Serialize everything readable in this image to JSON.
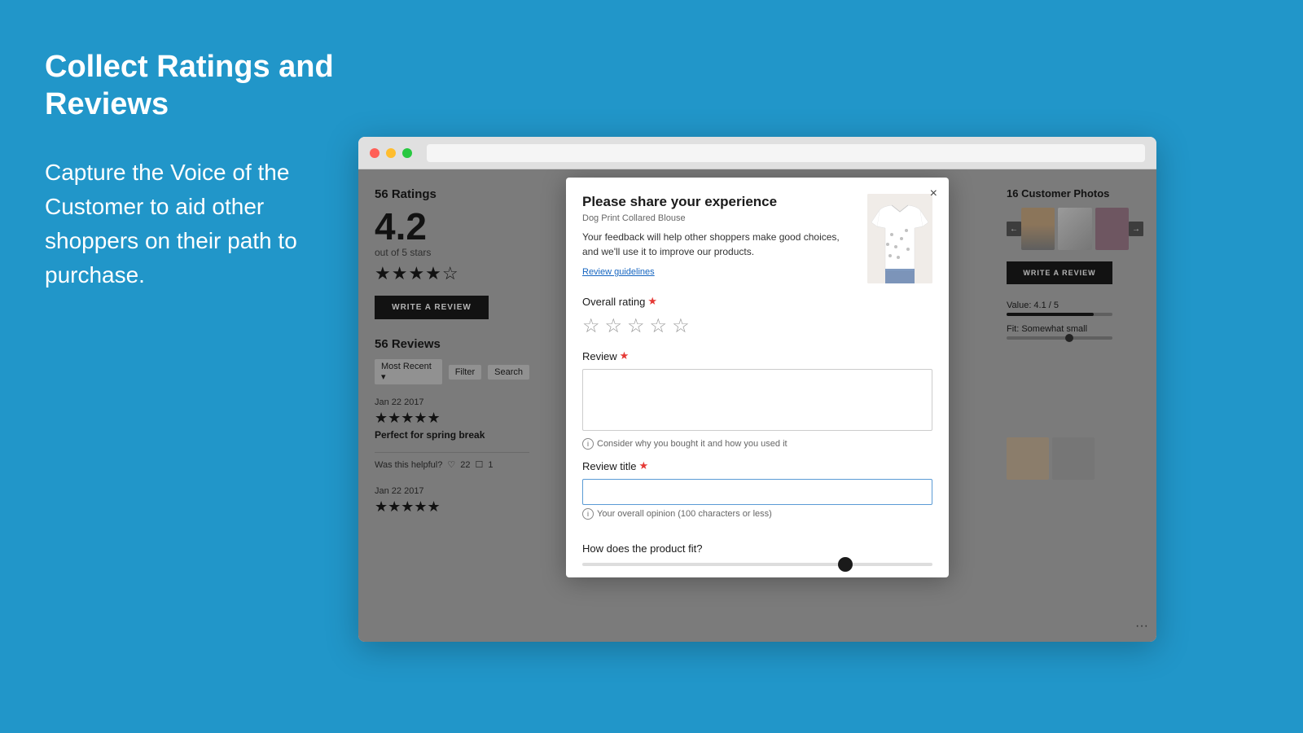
{
  "page": {
    "background_color": "#2196C9",
    "main_title": "Collect Ratings and Reviews",
    "subtitle": "Capture the Voice of the Customer to aid other shoppers on their path to purchase.",
    "browser": {
      "dots": [
        "red",
        "yellow",
        "green"
      ]
    },
    "ratings_section": {
      "title": "56 Ratings",
      "big_number": "4.2",
      "out_of": "out of 5 stars",
      "stars": "★★★★☆",
      "write_review_btn": "WRITE A REVIEW",
      "reviews_title": "56 Reviews",
      "filter_label": "Most Recent ▾",
      "filter_label2": "Filter",
      "search_label": "Search",
      "reviews": [
        {
          "date": "Jan 22 2017",
          "stars": "★★★★★",
          "text": "Perfect for spring break"
        },
        {
          "date": "Jan 22 2017",
          "stars": "★★★★★",
          "text": ""
        }
      ],
      "helpful_label": "Was this helpful?",
      "helpful_count": "22",
      "unhelpful_count": "1"
    },
    "right_section": {
      "customer_photos_title": "16 Customer Photos",
      "write_review_btn": "WRITE A REVIEW",
      "value_label": "Value: 4.1 / 5",
      "fit_label": "Fit: Somewhat small"
    },
    "modal": {
      "title": "Please share your experience",
      "product_name": "Dog Print Collared Blouse",
      "description": "Your feedback will help other shoppers make good choices, and we'll use it to improve our products.",
      "guidelines_link": "Review guidelines",
      "close_btn": "×",
      "overall_rating_label": "Overall rating",
      "review_label": "Review",
      "review_hint": "Consider why you bought it and how you used it",
      "review_title_label": "Review title",
      "review_title_hint": "Your overall opinion (100 characters or less)",
      "fit_label": "How does the product fit?",
      "stars": [
        "☆",
        "☆",
        "☆",
        "☆",
        "☆"
      ]
    }
  }
}
